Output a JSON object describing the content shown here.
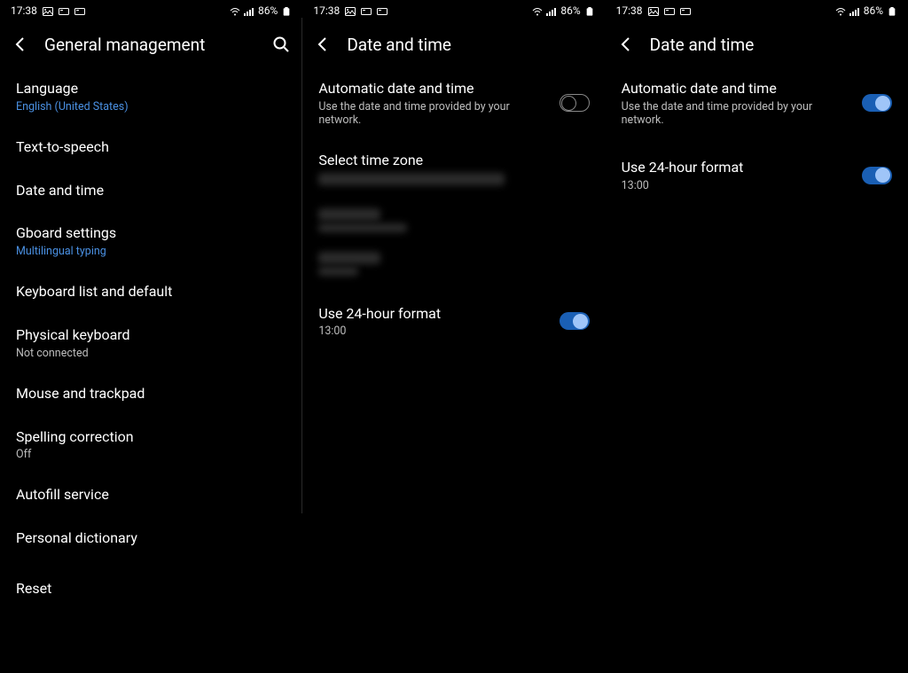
{
  "status": {
    "time": "17:38",
    "battery": "86%"
  },
  "screen1": {
    "title": "General management",
    "items": [
      {
        "title": "Language",
        "sub": "English (United States)",
        "sub_style": "blue"
      },
      {
        "title": "Text-to-speech"
      },
      {
        "title": "Date and time"
      },
      {
        "title": "Gboard settings",
        "sub": "Multilingual typing",
        "sub_style": "blue"
      },
      {
        "title": "Keyboard list and default"
      },
      {
        "title": "Physical keyboard",
        "sub": "Not connected",
        "sub_style": "dim"
      },
      {
        "title": "Mouse and trackpad"
      },
      {
        "title": "Spelling correction",
        "sub": "Off",
        "sub_style": "dim"
      },
      {
        "title": "Autofill service"
      },
      {
        "title": "Personal dictionary"
      },
      {
        "title": "Reset"
      }
    ]
  },
  "screen2": {
    "title": "Date and time",
    "auto": {
      "title": "Automatic date and time",
      "sub": "Use the date and time provided by your network.",
      "on": false
    },
    "select_tz": "Select time zone",
    "use24": {
      "title": "Use 24-hour format",
      "sub": "13:00",
      "on": true
    }
  },
  "screen3": {
    "title": "Date and time",
    "auto": {
      "title": "Automatic date and time",
      "sub": "Use the date and time provided by your network.",
      "on": true
    },
    "use24": {
      "title": "Use 24-hour format",
      "sub": "13:00",
      "on": true
    }
  }
}
